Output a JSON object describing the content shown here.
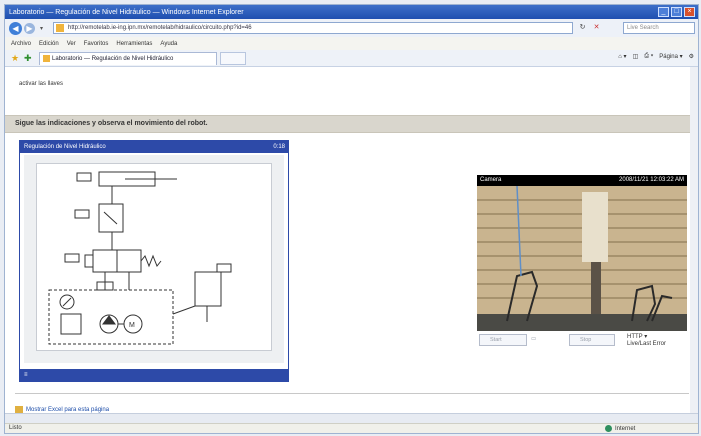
{
  "window": {
    "title": "Laboratorio — Regulación de Nivel Hidráulico — Windows Internet Explorer",
    "controls": [
      "_",
      "□",
      "×"
    ]
  },
  "address_bar": {
    "url": "http://remotelab.ie-ing.ipn.mx/remotelab/hidraulico/circuito.php?id=46"
  },
  "search": {
    "placeholder": "Live Search"
  },
  "menu": {
    "items": [
      "Archivo",
      "Edición",
      "Ver",
      "Favoritos",
      "Herramientas",
      "Ayuda"
    ]
  },
  "tab": {
    "label": "Laboratorio — Regulación de Nivel Hidráulico"
  },
  "command_bar": {
    "page_label": "Página",
    "tools_label": "Herramientas"
  },
  "page": {
    "instruction_text": "activar las llaves",
    "banner_text": "Sigue las indicaciones y observa el movimiento del robot.",
    "simulator": {
      "title": "Regulación de Nivel Hidráulico",
      "counter": "0:18"
    },
    "camera": {
      "label": "Camera",
      "timestamp": "2008/11/21 12:03:22 AM",
      "controls": {
        "start": "Start",
        "stop": "Stop",
        "protocol": "HTTP ▾",
        "mode": "Live/Last Error"
      }
    },
    "show_link": "Mostrar Excel para esta página"
  },
  "status_bar": {
    "left": "Listo",
    "zone": "Internet"
  }
}
